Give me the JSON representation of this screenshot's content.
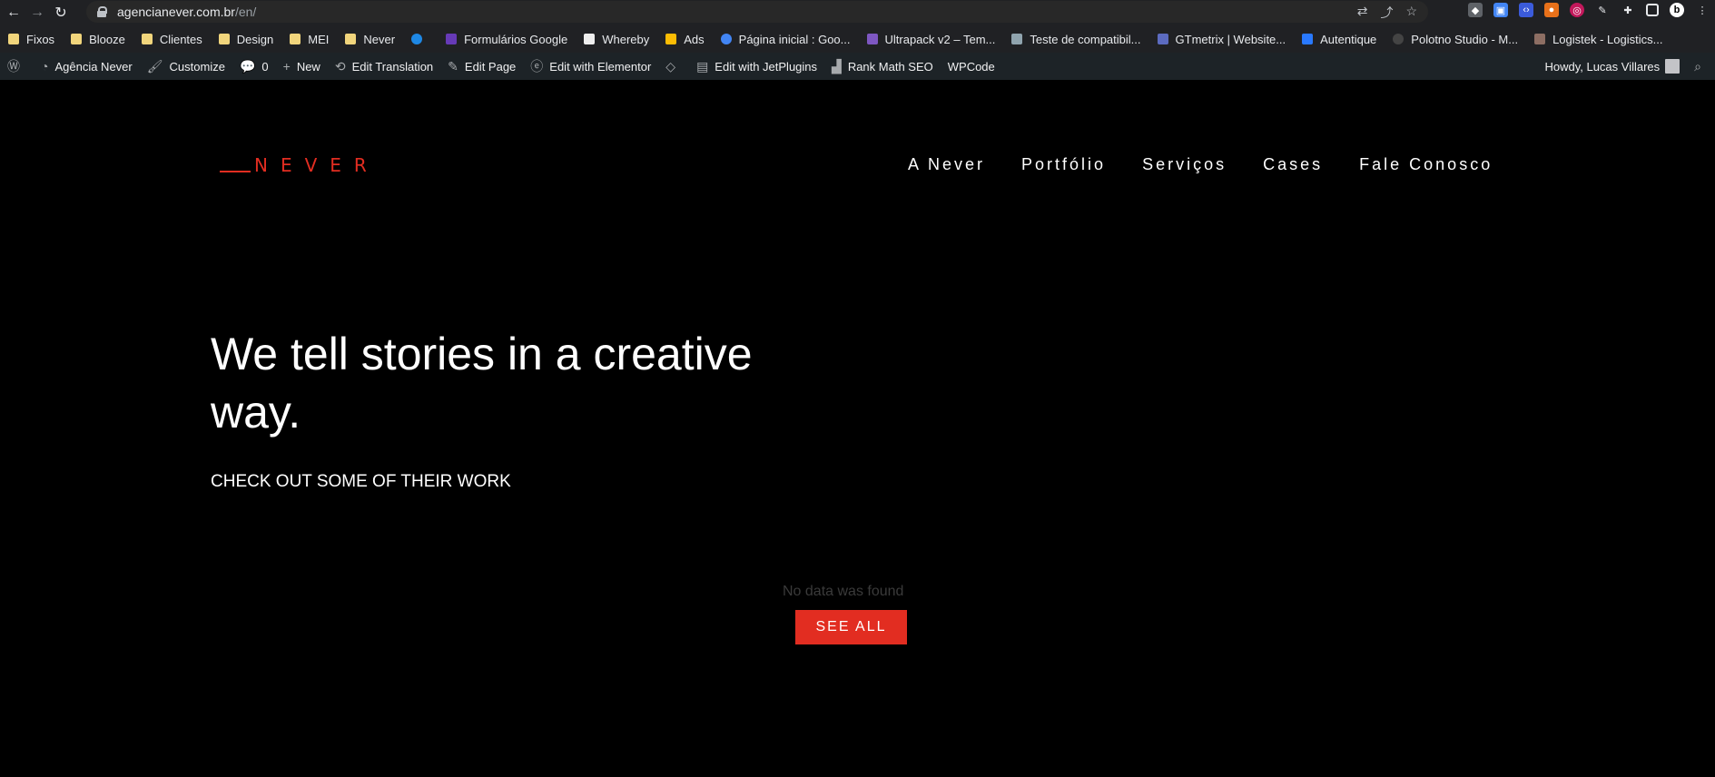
{
  "browser": {
    "url_host": "agencianever.com.br",
    "url_path": "/en/",
    "bookmarks": [
      {
        "label": "Fixos",
        "icon": "folder-icon"
      },
      {
        "label": "Blooze",
        "icon": "folder-icon"
      },
      {
        "label": "Clientes",
        "icon": "folder-icon"
      },
      {
        "label": "Design",
        "icon": "folder-icon"
      },
      {
        "label": "MEI",
        "icon": "folder-icon"
      },
      {
        "label": "Never",
        "icon": "folder-icon"
      },
      {
        "label": "",
        "icon": "onedrive-icon"
      },
      {
        "label": "Formulários Google",
        "icon": "google-forms-icon"
      },
      {
        "label": "Whereby",
        "icon": "whereby-icon"
      },
      {
        "label": "Ads",
        "icon": "google-ads-icon"
      },
      {
        "label": "Página inicial : Goo...",
        "icon": "google-icon"
      },
      {
        "label": "Ultrapack v2 – Tem...",
        "icon": "ultrapack-icon"
      },
      {
        "label": "Teste de compatibil...",
        "icon": "car-icon"
      },
      {
        "label": "GTmetrix | Website...",
        "icon": "gtmetrix-icon"
      },
      {
        "label": "Autentique",
        "icon": "autentique-icon"
      },
      {
        "label": "Polotno Studio - M...",
        "icon": "polotno-icon"
      },
      {
        "label": "Logistek - Logistics...",
        "icon": "logistek-icon"
      }
    ]
  },
  "wpbar": {
    "site_name": "Agência Never",
    "customize": "Customize",
    "comments": "0",
    "new": "New",
    "edit_translation": "Edit Translation",
    "edit_page": "Edit Page",
    "edit_elementor": "Edit with Elementor",
    "edit_jet": "Edit with JetPlugins",
    "rank_math": "Rank Math SEO",
    "wpcode": "WPCode",
    "howdy": "Howdy, Lucas Villares"
  },
  "site": {
    "logo_text": "NEVER",
    "menu": [
      "A Never",
      "Portfólio",
      "Serviços",
      "Cases",
      "Fale Conosco"
    ],
    "hero_title": "We tell stories in a creative way.",
    "subheading": "CHECK OUT SOME OF THEIR WORK",
    "empty_message": "No data was found",
    "see_all": "SEE ALL"
  },
  "colors": {
    "accent": "#e22d21",
    "background": "#000000",
    "admin_bar": "#1d2327"
  }
}
